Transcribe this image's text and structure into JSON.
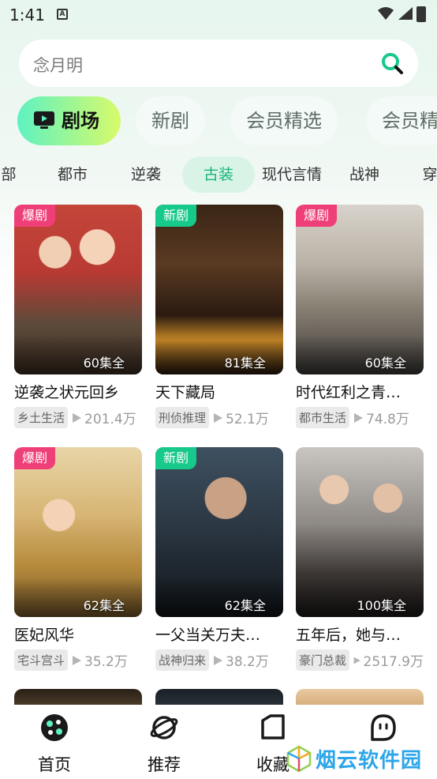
{
  "status_bar": {
    "time": "1:41",
    "notification_letter": "A"
  },
  "search": {
    "placeholder": "念月明"
  },
  "main_tabs": [
    "剧场",
    "新剧",
    "会员精选",
    "会员精"
  ],
  "categories": [
    "部",
    "都市",
    "逆袭",
    "古装",
    "现代言情",
    "战神",
    "穿"
  ],
  "active_category": "古装",
  "cards": [
    {
      "badge": "爆剧",
      "episodes": "60集全",
      "title": "逆袭之状元回乡",
      "tag": "乡土生活",
      "views": "201.4万"
    },
    {
      "badge": "新剧",
      "episodes": "81集全",
      "title": "天下藏局",
      "tag": "刑侦推理",
      "views": "52.1万"
    },
    {
      "badge": "爆剧",
      "episodes": "60集全",
      "title": "时代红利之青…",
      "tag": "都市生活",
      "views": "74.8万"
    },
    {
      "badge": "爆剧",
      "episodes": "62集全",
      "title": "医妃风华",
      "tag": "宅斗宫斗",
      "views": "35.2万"
    },
    {
      "badge": "新剧",
      "episodes": "62集全",
      "title": "一父当关万夫…",
      "tag": "战神归来",
      "views": "38.2万"
    },
    {
      "badge": "",
      "episodes": "100集全",
      "title": "五年后，她与…",
      "tag": "豪门总裁",
      "views": "2517.9万"
    }
  ],
  "bottom_nav": [
    "首页",
    "推荐",
    "收藏",
    ""
  ],
  "watermark": "烟云软件园",
  "colors": {
    "accent": "#17c98a",
    "hot_badge": "#ef3f78",
    "active_category_bg": "#d9f4e7"
  }
}
